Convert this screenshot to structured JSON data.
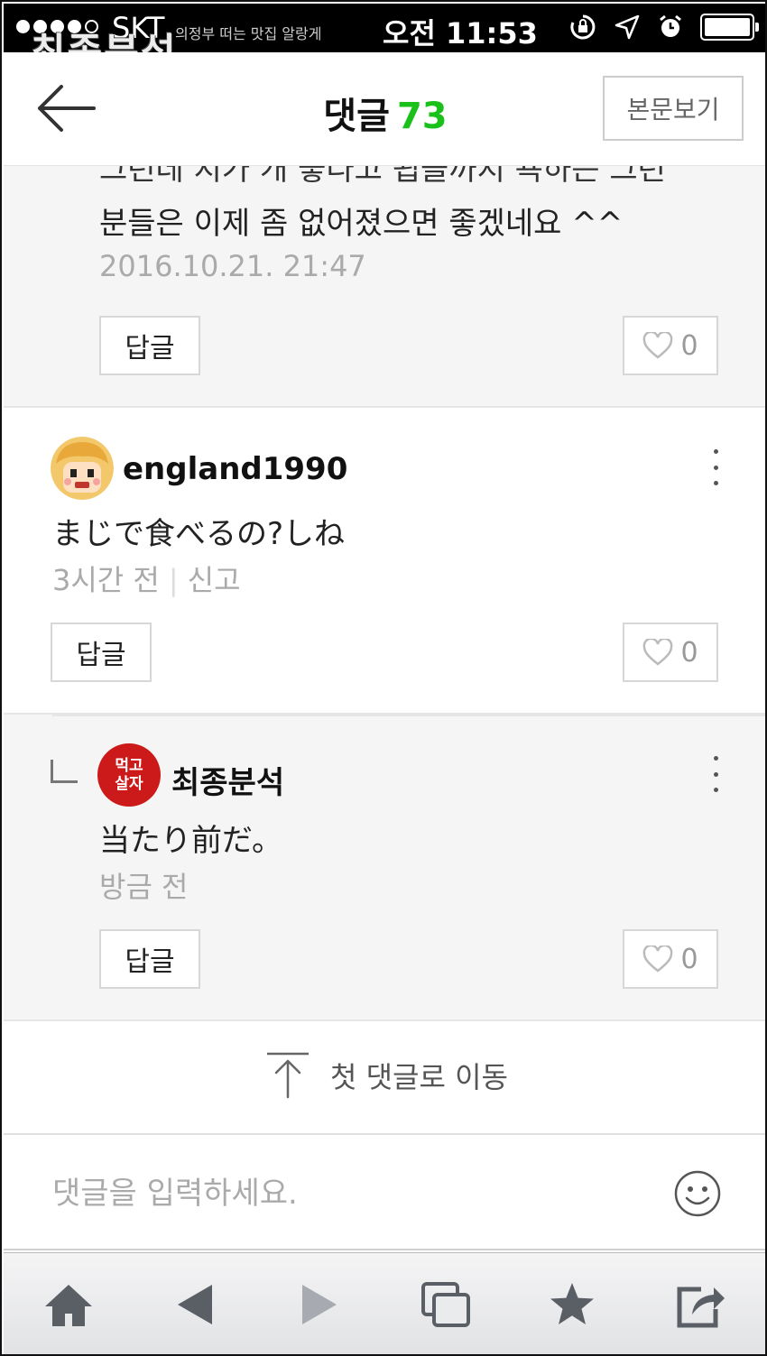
{
  "status_bar": {
    "carrier": "SKT",
    "time": "오전 11:53",
    "signal_bars_filled": 4,
    "signal_bars_total": 5,
    "watermark": "최종분석",
    "overlay_caption": "의정부 떠는 맛집 알랑게"
  },
  "header": {
    "title": "댓글",
    "comment_count": "73",
    "view_original_label": "본문보기"
  },
  "comments": [
    {
      "text_cut_line": "그런데 지가 개 좋다고 됩을까지 욕하는 그런",
      "text": "분들은 이제 좀 없어졌으면 좋겠네요 ^^",
      "timestamp": "2016.10.21. 21:47",
      "reply_label": "답글",
      "like_count": "0"
    },
    {
      "nickname": "england1990",
      "text": "まじで食べるの?しね",
      "time_ago": "3시간 전",
      "report_label": "신고",
      "reply_label": "답글",
      "like_count": "0"
    },
    {
      "nickname": "최종분석",
      "avatar_text_top": "먹고",
      "avatar_text_bottom": "살자",
      "text": "当たり前だ。",
      "time_ago": "방금 전",
      "reply_label": "답글",
      "like_count": "0"
    }
  ],
  "jump_to_first_label": "첫 댓글로 이동",
  "input": {
    "placeholder": "댓글을 입력하세요."
  },
  "toolbar": {
    "icons": [
      "home-icon",
      "back-icon",
      "forward-icon",
      "tabs-icon",
      "bookmark-star-icon",
      "share-icon"
    ]
  },
  "colors": {
    "count_green": "#19c11a",
    "avatar_red": "#cc1a1a"
  }
}
